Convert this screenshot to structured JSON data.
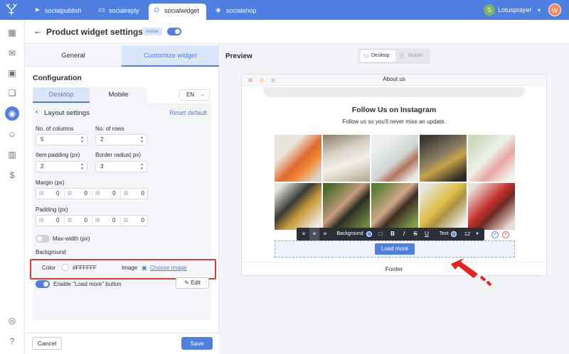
{
  "topbar": {
    "logo_icon": "antler-logo-icon",
    "tabs": [
      {
        "label": "socialpublish",
        "icon": "paper-plane-icon"
      },
      {
        "label": "socialreply",
        "icon": "chat-bubble-icon"
      },
      {
        "label": "socialwidget",
        "icon": "widget-icon"
      },
      {
        "label": "socialshop",
        "icon": "shop-tag-icon"
      }
    ],
    "active_tab": "socialwidget",
    "store_name": "Lotusprayer",
    "avatar_letter": "W",
    "color": "#4f7fe0"
  },
  "rail_icons": [
    "dashboard-icon",
    "inbox-icon",
    "image-icon",
    "book-icon",
    "layers-icon",
    "user-icon",
    "analytics-icon",
    "money-bag-icon",
    "support-icon",
    "help-icon"
  ],
  "header": {
    "title": "Product widget settings",
    "status_badge": "Active",
    "enabled": true
  },
  "panel": {
    "tabs": [
      "General",
      "Customize widget"
    ],
    "active_tab": "Customize widget",
    "config_title": "Configuration",
    "device_tabs": [
      "Desktop",
      "Mobile"
    ],
    "active_device": "Desktop",
    "language": "EN",
    "layout_title": "Layout settings",
    "reset_label": "Reset default",
    "columns_label": "No. of columns",
    "columns_value": "5",
    "rows_label": "No. of rows",
    "rows_value": "2",
    "item_padding_label": "Item padding (px)",
    "item_padding_value": "2",
    "border_radius_label": "Border radius( px)",
    "border_radius_value": "3",
    "margin_label": "Margin (px)",
    "margin_values": [
      "0",
      "0",
      "0",
      "0"
    ],
    "padding_label": "Padding (px)",
    "padding_values": [
      "0",
      "0",
      "0",
      "0"
    ],
    "max_width_label": "Max-width (px)",
    "max_width_enabled": false,
    "background_label": "Background",
    "color_label": "Color",
    "color_value": "#FFFFFF",
    "image_label": "Image",
    "choose_image_label": "Choose image",
    "load_more_toggle_label": "Enable \"Load more\" button",
    "load_more_enabled": true,
    "edit_label": "Edit"
  },
  "footer": {
    "cancel_label": "Cancel",
    "save_label": "Save"
  },
  "preview": {
    "title": "Preview",
    "device_options": [
      "Desktop",
      "Mobile"
    ],
    "active_device": "Desktop",
    "page_title": "About us",
    "widget_title": "Follow Us on Instagram",
    "widget_subtitle": "Follow us so you'll never miss an update.",
    "photo_count": 10,
    "toolbar": {
      "background_label": "Background",
      "bold": "B",
      "italic": "I",
      "strike": "S",
      "underline": "U",
      "text_label": "Text",
      "font_size": "12"
    },
    "load_more_label": "Load more",
    "footer_label": "Footer"
  }
}
